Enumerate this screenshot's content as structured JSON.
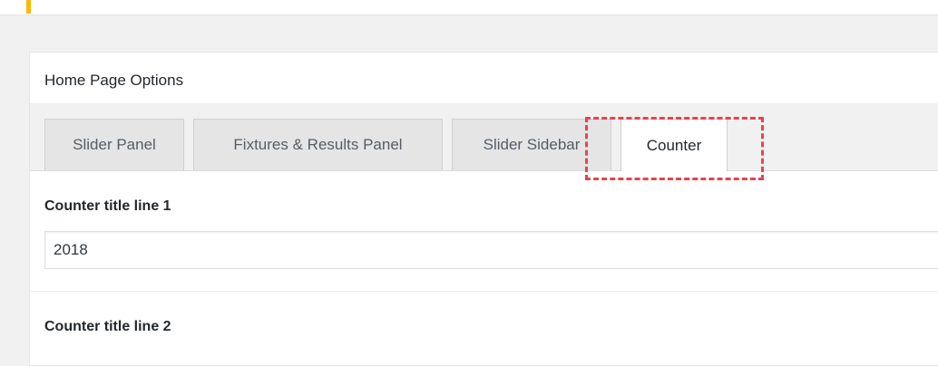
{
  "panel": {
    "title": "Home Page Options"
  },
  "tabs": [
    {
      "label": "Slider Panel",
      "active": false
    },
    {
      "label": "Fixtures & Results Panel",
      "active": false
    },
    {
      "label": "Slider Sidebar",
      "active": false
    },
    {
      "label": "Counter",
      "active": true
    }
  ],
  "fields": [
    {
      "label": "Counter title line 1",
      "value": "2018"
    },
    {
      "label": "Counter title line 2"
    }
  ],
  "colors": {
    "accent": "#ffb900",
    "highlight": "#e8424f"
  }
}
